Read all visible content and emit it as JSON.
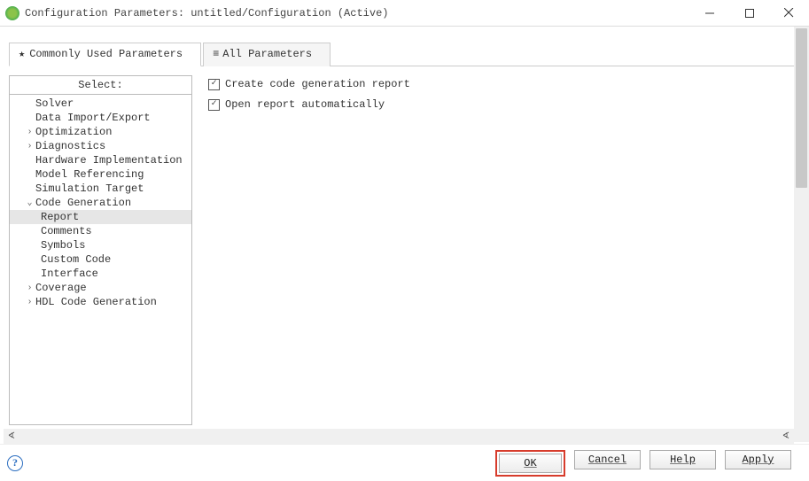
{
  "title": "Configuration Parameters: untitled/Configuration (Active)",
  "tabs": {
    "commonly": "Commonly Used Parameters",
    "all": "All Parameters"
  },
  "sidebar": {
    "header": "Select:",
    "items": [
      {
        "label": "Solver",
        "indent": 1,
        "arrow": ""
      },
      {
        "label": "Data Import/Export",
        "indent": 1,
        "arrow": ""
      },
      {
        "label": "Optimization",
        "indent": 1,
        "arrow": "›",
        "hasArrow": true
      },
      {
        "label": "Diagnostics",
        "indent": 1,
        "arrow": "›",
        "hasArrow": true
      },
      {
        "label": "Hardware Implementation",
        "indent": 1,
        "arrow": ""
      },
      {
        "label": "Model Referencing",
        "indent": 1,
        "arrow": ""
      },
      {
        "label": "Simulation Target",
        "indent": 1,
        "arrow": ""
      },
      {
        "label": "Code Generation",
        "indent": 1,
        "arrow": "⌄",
        "hasArrow": true
      },
      {
        "label": "Report",
        "indent": 2,
        "arrow": "",
        "selected": true
      },
      {
        "label": "Comments",
        "indent": 2,
        "arrow": ""
      },
      {
        "label": "Symbols",
        "indent": 2,
        "arrow": ""
      },
      {
        "label": "Custom Code",
        "indent": 2,
        "arrow": ""
      },
      {
        "label": "Interface",
        "indent": 2,
        "arrow": ""
      },
      {
        "label": "Coverage",
        "indent": 1,
        "arrow": "›",
        "hasArrow": true
      },
      {
        "label": "HDL Code Generation",
        "indent": 1,
        "arrow": "›",
        "hasArrow": true
      }
    ]
  },
  "options": {
    "create_report": {
      "label": "Create code generation report",
      "checked": true
    },
    "open_auto": {
      "label": "Open report automatically",
      "checked": true
    }
  },
  "buttons": {
    "ok": "OK",
    "cancel": "Cancel",
    "help": "Help",
    "apply": "Apply"
  }
}
